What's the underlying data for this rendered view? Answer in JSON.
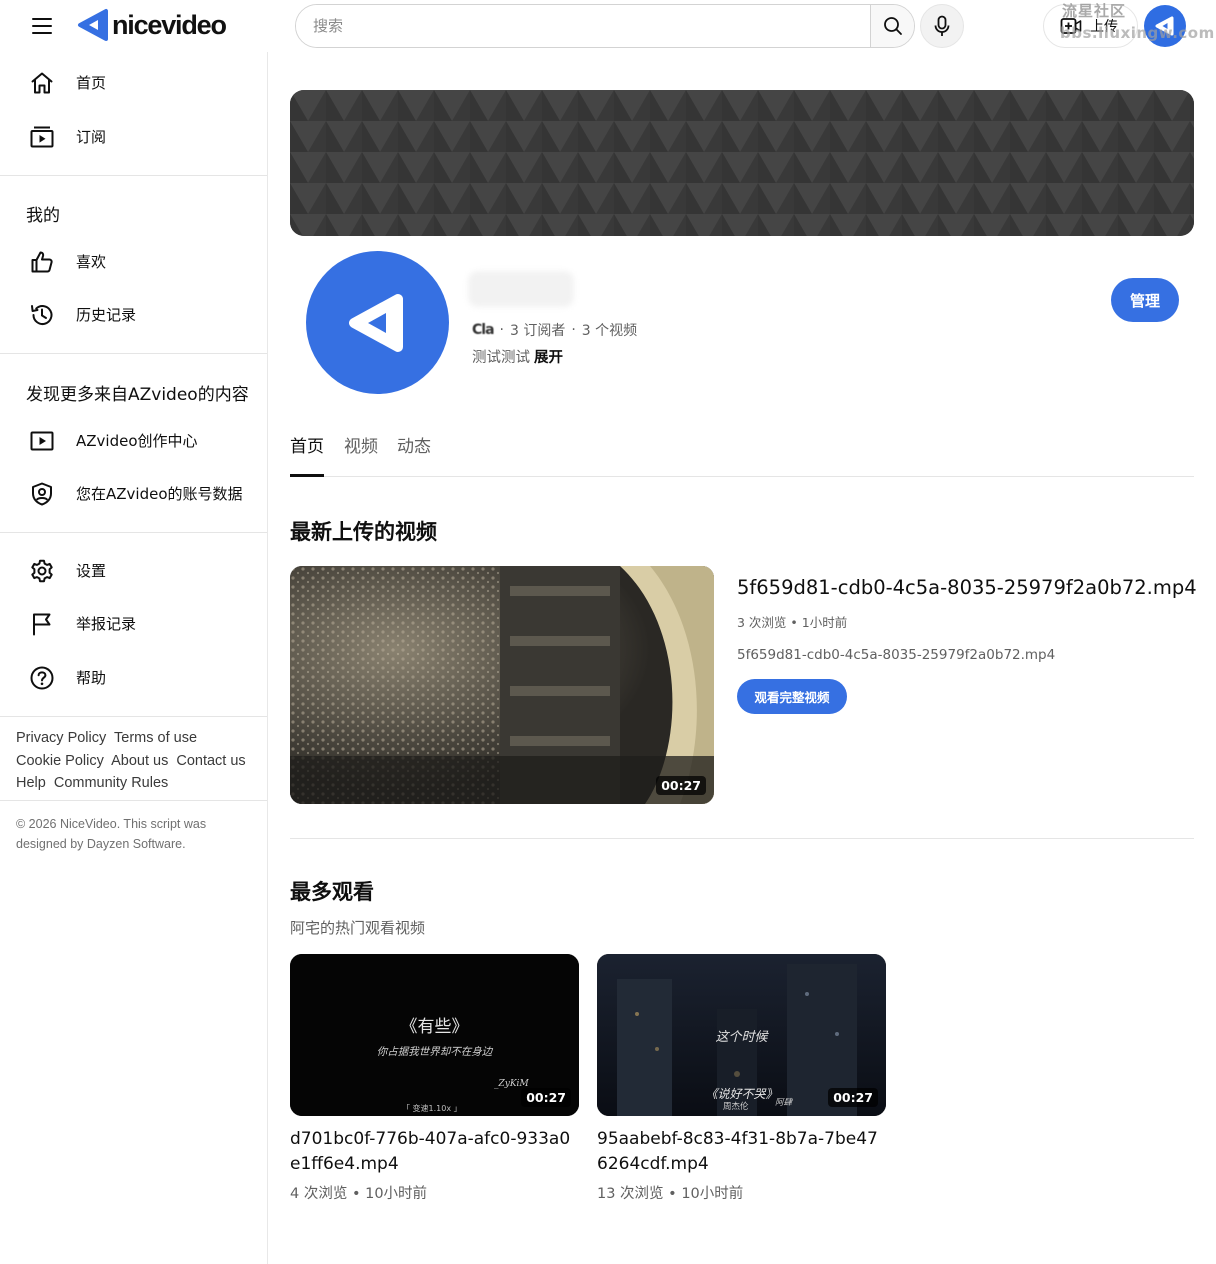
{
  "header": {
    "logo_text": "nicevideo",
    "search_placeholder": "搜索",
    "upload_label": "上传",
    "watermark_line1": "流星社区",
    "watermark_line2": "bbs.liuxingw.com"
  },
  "colors": {
    "brand_blue": "#3670e2",
    "text_primary": "#0f0f0f",
    "text_secondary": "#606060"
  },
  "sidebar": {
    "main_items": [
      {
        "label": "首页",
        "icon": "home-icon"
      },
      {
        "label": "订阅",
        "icon": "subscriptions-icon"
      }
    ],
    "mine_heading": "我的",
    "mine_items": [
      {
        "label": "喜欢",
        "icon": "thumbs-up-icon"
      },
      {
        "label": "历史记录",
        "icon": "history-icon"
      }
    ],
    "more_heading": "发现更多来自AZvideo的内容",
    "more_items": [
      {
        "label": "AZvideo创作中心",
        "icon": "play-box-icon"
      },
      {
        "label": "您在AZvideo的账号数据",
        "icon": "shield-user-icon"
      }
    ],
    "settings_items": [
      {
        "label": "设置",
        "icon": "gear-icon"
      },
      {
        "label": "举报记录",
        "icon": "flag-icon"
      },
      {
        "label": "帮助",
        "icon": "help-icon"
      }
    ],
    "footer_links": [
      "Privacy Policy",
      "Terms of use",
      "Cookie Policy",
      "About us",
      "Contact us",
      "Help",
      "Community Rules"
    ],
    "copyright": "© 2026 NiceVideo. This script was designed by Dayzen Software."
  },
  "channel": {
    "handle": "Cla",
    "subscribers": "3 订阅者",
    "video_count": "3 个视频",
    "description": "测试测试",
    "expand_label": "展开",
    "manage_label": "管理"
  },
  "tabs": [
    {
      "label": "首页",
      "active": true
    },
    {
      "label": "视频",
      "active": false
    },
    {
      "label": "动态",
      "active": false
    }
  ],
  "latest": {
    "section_title": "最新上传的视频",
    "title": "5f659d81-cdb0-4c5a-8035-25979f2a0b72.mp4",
    "meta": "3 次浏览 • 1小时前",
    "description": "5f659d81-cdb0-4c5a-8035-25979f2a0b72.mp4",
    "duration": "00:27",
    "watch_label": "观看完整视频"
  },
  "popular": {
    "section_title": "最多观看",
    "subtitle": "阿宅的热门观看视频",
    "videos": [
      {
        "title": "d701bc0f-776b-407a-afc0-933a0e1ff6e4.mp4",
        "meta": "4 次浏览 • 10小时前",
        "duration": "00:27",
        "thumb_line1": "《有些》",
        "thumb_line2": "你占据我世界却不在身边",
        "thumb_sign": "_ZyKiM",
        "thumb_speed": "「 变速1.10x 」"
      },
      {
        "title": "95aabebf-8c83-4f31-8b7a-7be476264cdf.mp4",
        "meta": "13 次浏览 • 10小时前",
        "duration": "00:27",
        "thumb_line1": "这个时候",
        "thumb_line2": "《说好不哭》",
        "thumb_sign": "周杰伦",
        "thumb_speed": "阿肆"
      }
    ]
  }
}
